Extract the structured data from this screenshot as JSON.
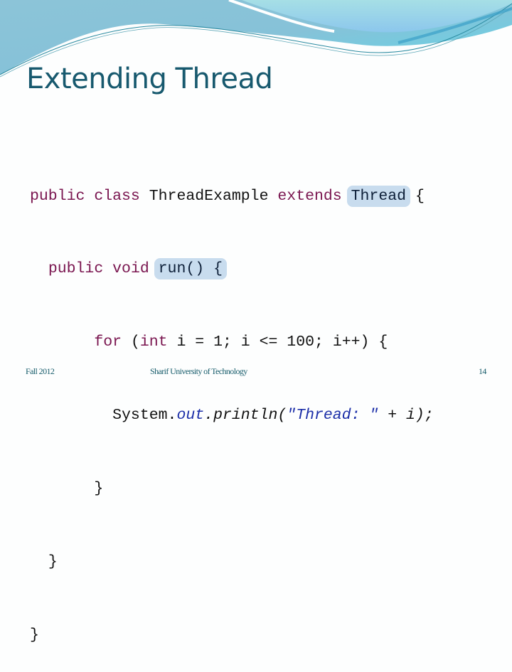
{
  "slide": {
    "title": "Extending Thread",
    "code": {
      "l1": {
        "kw1": "public",
        "kw2": "class",
        "name": "ThreadExample",
        "kw3": "extends",
        "super": "Thread",
        "brace": "{"
      },
      "l2": {
        "kw1": "public",
        "kw2": "void",
        "method": "run()",
        "brace": "{"
      },
      "l3": {
        "kw1": "for",
        "open": "(",
        "kw2": "int",
        "rest": "i = 1; i <= 100; i++) {"
      },
      "l4": {
        "obj": "System.",
        "field": "out",
        "call": ".println(",
        "str": "\"Thread: \"",
        "rest": " + i);"
      },
      "l5": "}",
      "l6": "}",
      "l7": "}"
    },
    "colors": {
      "title": "#17596e",
      "keyword": "#7a1650",
      "highlight": "#c8dcee",
      "string": "#1b2ea8"
    }
  },
  "footer": {
    "left": "Fall 2012",
    "center": "Sharif University of Technology",
    "page_number": "14"
  }
}
